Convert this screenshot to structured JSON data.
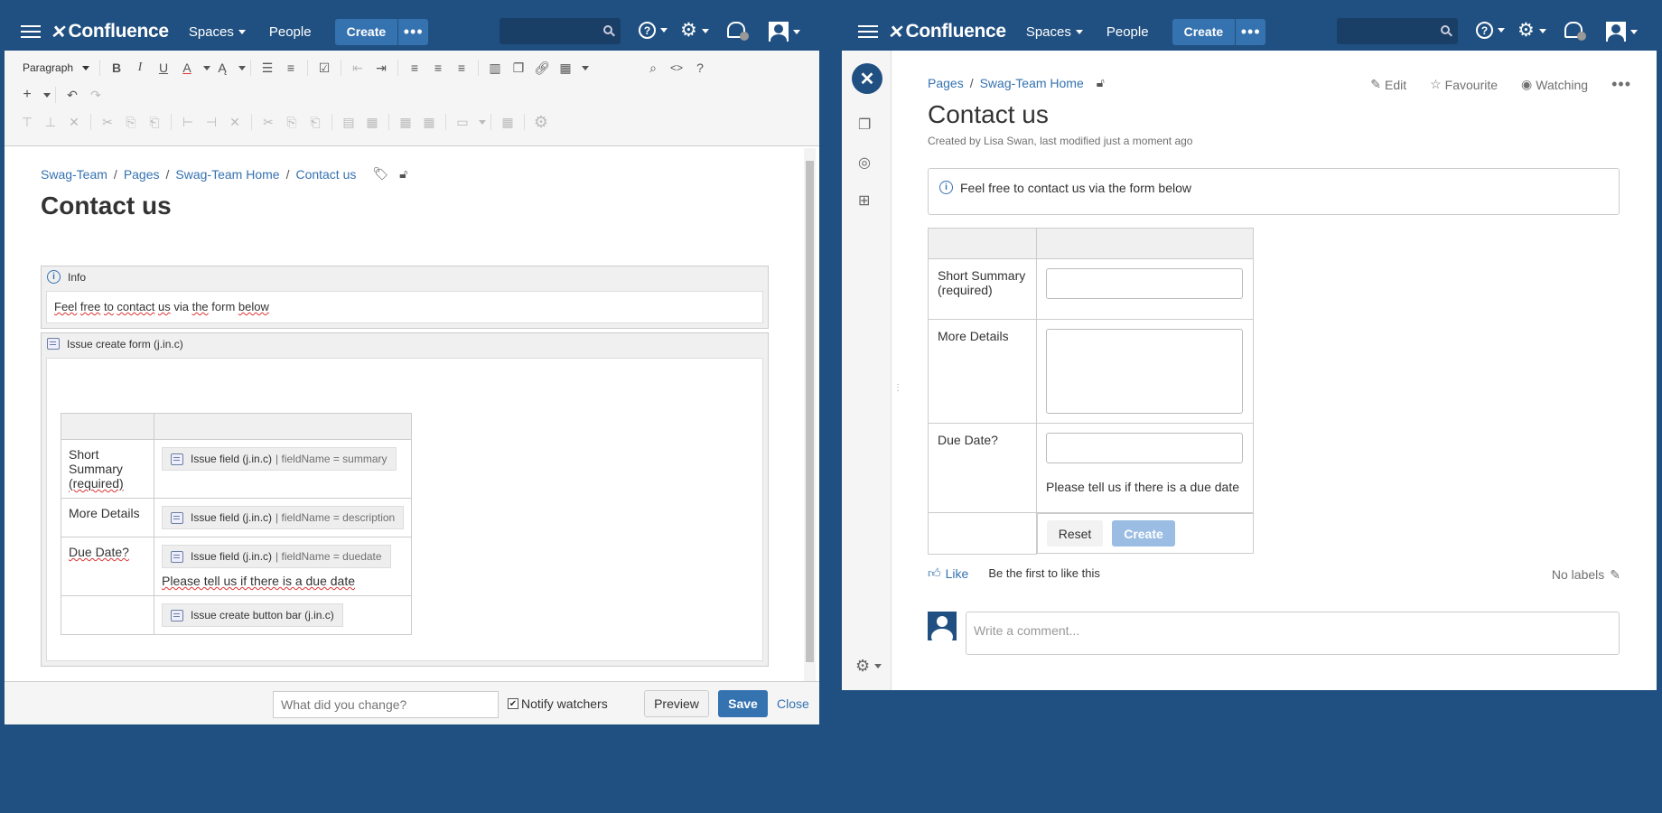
{
  "brand": "Confluence",
  "nav": {
    "spaces": "Spaces",
    "people": "People",
    "create": "Create",
    "more": "•••"
  },
  "editor": {
    "paragraph_style": "Paragraph",
    "breadcrumbs": [
      "Swag-Team",
      "Pages",
      "Swag-Team Home",
      "Contact us"
    ],
    "title": "Contact us",
    "info_macro": {
      "header": "Info",
      "body_words": [
        "Feel",
        "free",
        "to",
        "contact",
        "us",
        "via",
        "the",
        "form",
        "below"
      ]
    },
    "form_macro": {
      "header": "Issue create form (j.in.c)"
    },
    "rows": [
      {
        "label_a": "Short Summary",
        "label_b": "(required)",
        "chip": "Issue field (j.in.c)",
        "param": "| fieldName = summary"
      },
      {
        "label_a": "More Details",
        "label_b": "",
        "chip": "Issue field (j.in.c)",
        "param": "| fieldName = description"
      },
      {
        "label_a": "Due Date?",
        "label_b": "",
        "chip": "Issue field (j.in.c)",
        "param": "| fieldName = duedate",
        "hint": "Please tell us if there is a due date"
      },
      {
        "label_a": "",
        "label_b": "",
        "chip": "Issue create button bar (j.in.c)",
        "param": ""
      }
    ],
    "footer": {
      "change_placeholder": "What did you change?",
      "notify": "Notify watchers",
      "notify_checked": true,
      "preview": "Preview",
      "save": "Save",
      "close": "Close"
    }
  },
  "view": {
    "breadcrumbs": [
      "Pages",
      "Swag-Team Home"
    ],
    "actions": {
      "edit": "Edit",
      "favourite": "Favourite",
      "watching": "Watching"
    },
    "title": "Contact us",
    "byline": "Created by Lisa Swan, last modified just a moment ago",
    "info_text": "Feel free to contact us via the form below",
    "form": {
      "summary_label_a": "Short Summary",
      "summary_label_b": "(required)",
      "details_label": "More Details",
      "due_label": "Due Date?",
      "due_hint": "Please tell us if there is a due date",
      "reset": "Reset",
      "create": "Create"
    },
    "like": "Like",
    "like_text": "Be the first to like this",
    "no_labels": "No labels",
    "comment_placeholder": "Write a comment..."
  },
  "colors": {
    "header_bg": "#205081",
    "link": "#3572b0",
    "primary_button": "#3572b0"
  }
}
